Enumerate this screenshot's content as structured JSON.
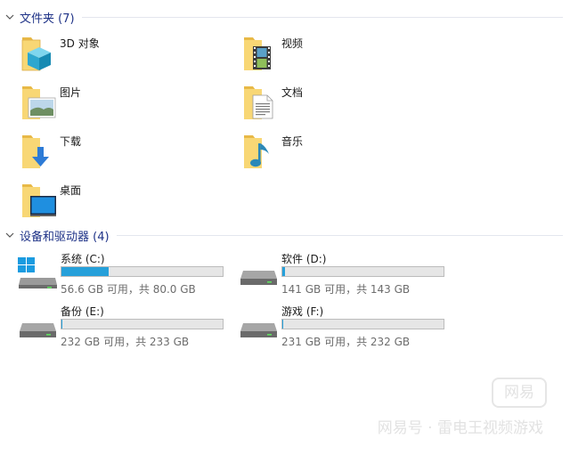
{
  "sections": {
    "folders": {
      "title": "文件夹 (7)"
    },
    "devices": {
      "title": "设备和驱动器 (4)"
    }
  },
  "folders": [
    {
      "label": "3D 对象",
      "icon": "3d-objects-folder-icon"
    },
    {
      "label": "视频",
      "icon": "videos-folder-icon"
    },
    {
      "label": "图片",
      "icon": "pictures-folder-icon"
    },
    {
      "label": "文档",
      "icon": "documents-folder-icon"
    },
    {
      "label": "下载",
      "icon": "downloads-folder-icon"
    },
    {
      "label": "音乐",
      "icon": "music-folder-icon"
    },
    {
      "label": "桌面",
      "icon": "desktop-folder-icon"
    }
  ],
  "drives": [
    {
      "name": "系统 (C:)",
      "space": "56.6 GB 可用，共 80.0 GB",
      "used_fraction": 0.2925,
      "icon": "windows-drive-icon"
    },
    {
      "name": "软件 (D:)",
      "space": "141 GB 可用，共 143 GB",
      "used_fraction": 0.014,
      "icon": "hard-drive-icon"
    },
    {
      "name": "备份 (E:)",
      "space": "232 GB 可用，共 233 GB",
      "used_fraction": 0.0043,
      "icon": "hard-drive-icon"
    },
    {
      "name": "游戏 (F:)",
      "space": "231 GB 可用，共 232 GB",
      "used_fraction": 0.0043,
      "icon": "hard-drive-icon"
    }
  ],
  "watermark": {
    "badge": "网易",
    "line": "网易号 · 雷电王视频游戏"
  },
  "colors": {
    "accent": "#26a0da",
    "section_title": "#1e3287",
    "folder": "#f8d775"
  }
}
